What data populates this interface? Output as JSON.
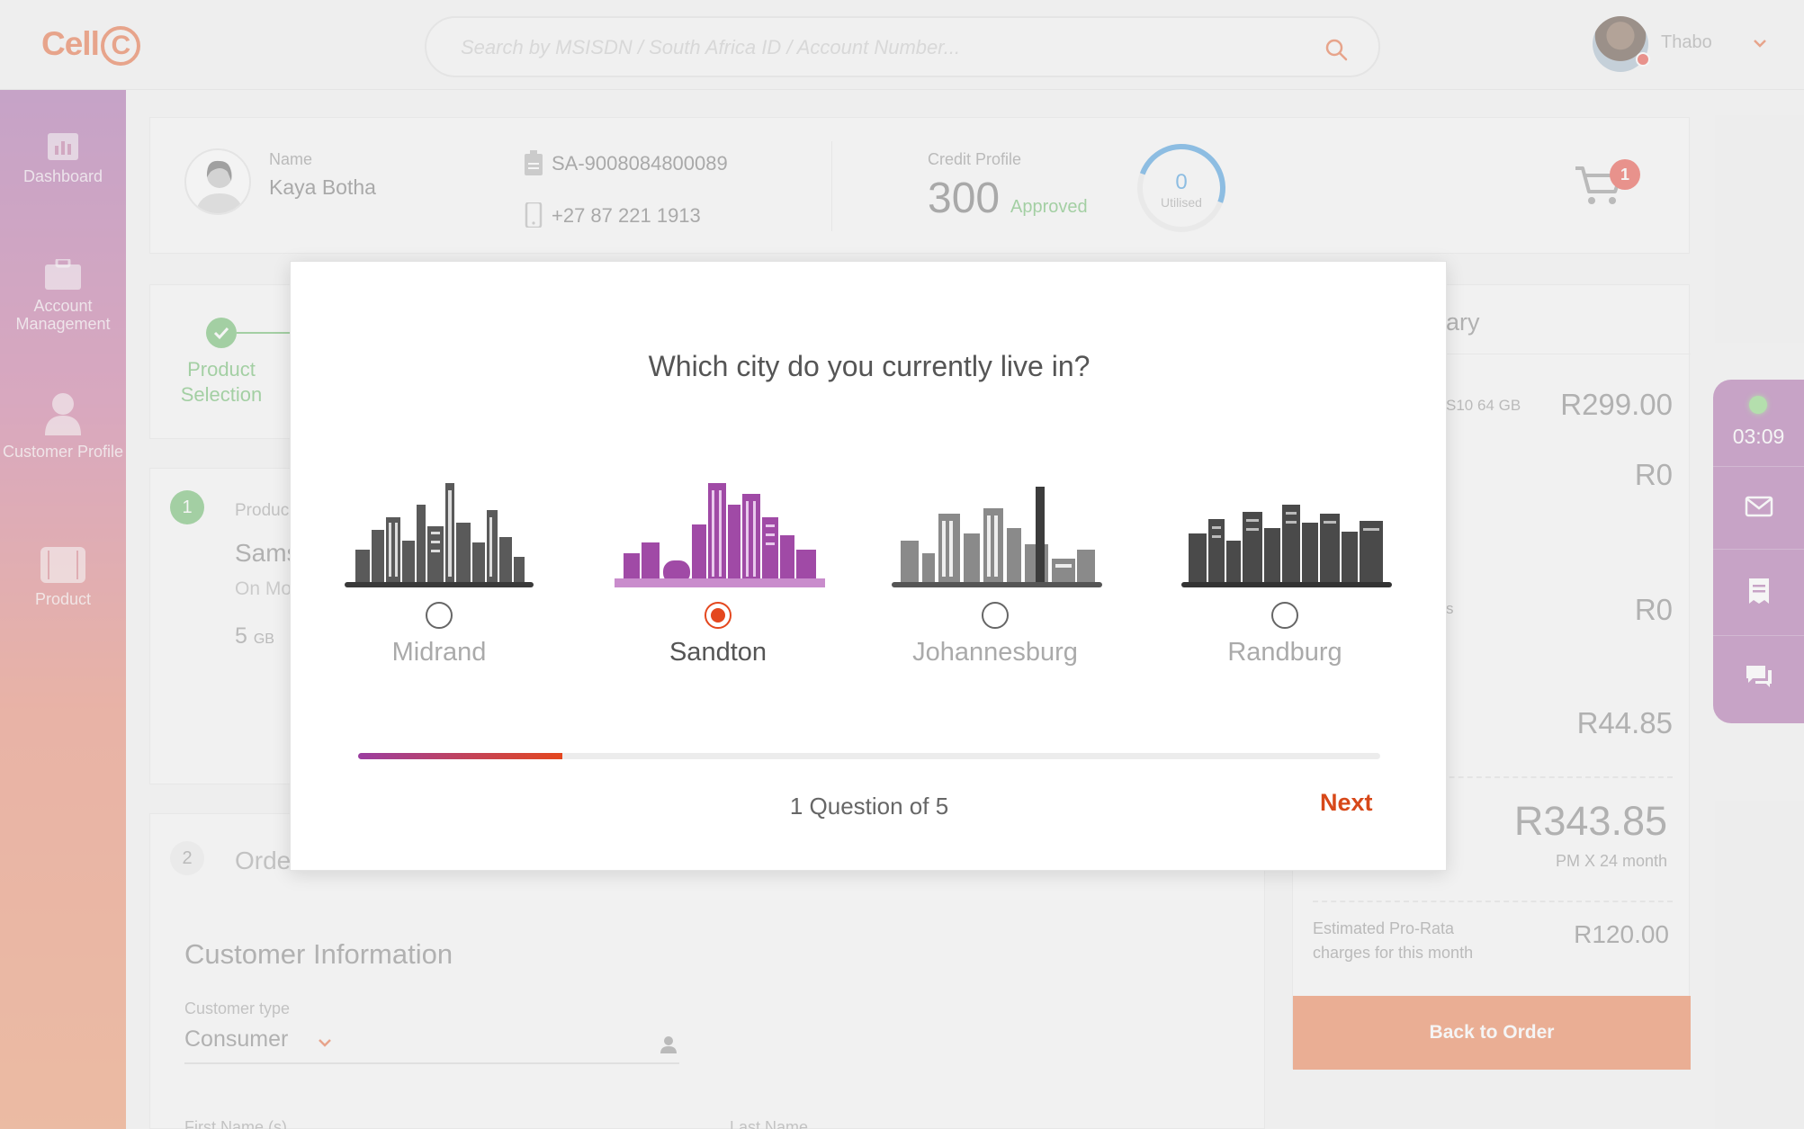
{
  "header": {
    "logo": "Cell",
    "logo_c": "C",
    "search_placeholder": "Search by MSISDN / South Africa ID / Account Number...",
    "user_name": "Thabo"
  },
  "sidebar": {
    "items": [
      {
        "label": "Dashboard",
        "icon": "bar-chart-icon"
      },
      {
        "label": "Account Management",
        "icon": "briefcase-icon"
      },
      {
        "label": "Customer Profile",
        "icon": "person-icon"
      },
      {
        "label": "Product",
        "icon": "phone-icon"
      }
    ]
  },
  "customer": {
    "name_label": "Name",
    "name": "Kaya Botha",
    "id": "SA-9008084800089",
    "phone": "+27 87 221 1913",
    "credit_label": "Credit Profile",
    "credit_score": "300",
    "credit_status": "Approved",
    "utilised_value": "0",
    "utilised_label": "Utilised",
    "cart_count": "1"
  },
  "stepper": {
    "step1_label": "Product Selection"
  },
  "product": {
    "number": "1",
    "label": "Produc",
    "name": "Sams",
    "sub": "On Mo",
    "data_value": "5",
    "data_unit": "GB"
  },
  "order": {
    "number": "2",
    "title": "Orde",
    "customer_info_title": "Customer Information",
    "customer_type_label": "Customer type",
    "customer_type_value": "Consumer",
    "first_name_label": "First Name (s)",
    "last_name_label": "Last Name"
  },
  "summary": {
    "title_fragment": "ary",
    "device_fragment": "S10 64 GB",
    "device_price": "R299.00",
    "row2_value": "R0",
    "row3_fragment": "s",
    "row3_value": "R0",
    "row4_value": "R44.85",
    "total": "R343.85",
    "total_sub": "PM X 24 month",
    "prorata_label": "Estimated Pro-Rata charges for this month",
    "prorata_value": "R120.00",
    "back_button": "Back to Order"
  },
  "tools": {
    "timer": "03:09",
    "status": "online"
  },
  "modal": {
    "question": "Which city do you currently live in?",
    "options": [
      {
        "name": "Midrand",
        "selected": false
      },
      {
        "name": "Sandton",
        "selected": true
      },
      {
        "name": "Johannesburg",
        "selected": false
      },
      {
        "name": "Randburg",
        "selected": false
      }
    ],
    "progress_fraction": 0.2,
    "question_count": "1 Question of 5",
    "next_label": "Next"
  },
  "colors": {
    "brand_orange": "#e35d2a",
    "brand_purple": "#a05aa3",
    "success_green": "#5bb35b",
    "next_red": "#d74819"
  }
}
